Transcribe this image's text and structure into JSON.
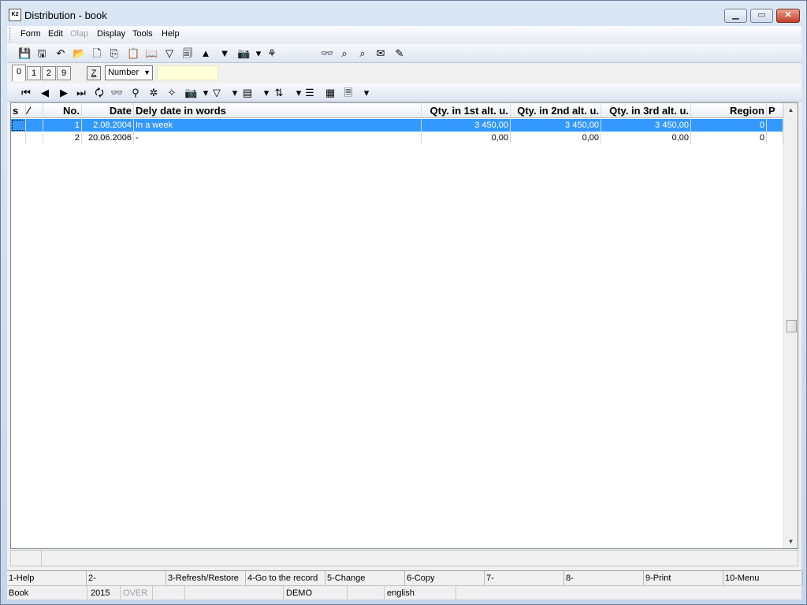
{
  "window": {
    "title": "Distribution - book",
    "icon_label": "K2",
    "min_glyph": "▁",
    "max_glyph": "▭",
    "close_glyph": "✕"
  },
  "menu": {
    "items": [
      {
        "label": "Form",
        "enabled": true
      },
      {
        "label": "Edit",
        "enabled": true
      },
      {
        "label": "Olap",
        "enabled": false
      },
      {
        "label": "Display",
        "enabled": true
      },
      {
        "label": "Tools",
        "enabled": true
      },
      {
        "label": "Help",
        "enabled": true
      }
    ]
  },
  "toolbar1": {
    "icons": [
      {
        "name": "save-icon",
        "glyph": "💾"
      },
      {
        "name": "save-disabled-icon",
        "glyph": "🖫"
      },
      {
        "name": "undo-icon",
        "glyph": "↶"
      },
      {
        "name": "open-folder-icon",
        "glyph": "📂"
      },
      {
        "name": "new-document-icon",
        "glyph": "🗋"
      },
      {
        "name": "copy-icon",
        "glyph": "⎘"
      },
      {
        "name": "paste-icon",
        "glyph": "📋"
      },
      {
        "name": "book-icon",
        "glyph": "📖"
      },
      {
        "name": "filter-icon",
        "glyph": "▽"
      },
      {
        "name": "filter-document-icon",
        "glyph": "🗐"
      },
      {
        "name": "arrow-up-icon",
        "glyph": "▲"
      },
      {
        "name": "arrow-down-icon",
        "glyph": "▼"
      },
      {
        "name": "camera-icon",
        "glyph": "📷"
      },
      {
        "name": "dropdown-icon",
        "glyph": "▾"
      },
      {
        "name": "plant-icon",
        "glyph": "⚘"
      },
      {
        "name": "binoculars-icon",
        "glyph": "👓"
      },
      {
        "name": "binoculars-find-icon",
        "glyph": "⌕"
      },
      {
        "name": "binoculars-next-icon",
        "glyph": "⌕"
      },
      {
        "name": "mail-icon",
        "glyph": "✉"
      },
      {
        "name": "disabled-edit-icon",
        "glyph": "✎"
      }
    ]
  },
  "tabs": {
    "items": [
      "0",
      "1",
      "2",
      "9"
    ],
    "active": "0",
    "z_button": "Z",
    "sort_select": "Number",
    "search_value": ""
  },
  "toolbar2": {
    "icons": [
      {
        "name": "first-record-icon",
        "glyph": "⏮"
      },
      {
        "name": "previous-record-icon",
        "glyph": "◀"
      },
      {
        "name": "next-record-icon",
        "glyph": "▶"
      },
      {
        "name": "last-record-icon",
        "glyph": "⏭"
      },
      {
        "name": "refresh-document-icon",
        "glyph": "🗘"
      },
      {
        "name": "binoculars-icon",
        "glyph": "👓"
      },
      {
        "name": "disabled-binoculars-icon",
        "glyph": "⚲"
      },
      {
        "name": "star-add-icon",
        "glyph": "✲"
      },
      {
        "name": "disabled-remove-icon",
        "glyph": "✧"
      },
      {
        "name": "camera-icon",
        "glyph": "📷"
      },
      {
        "name": "dropdown-icon",
        "glyph": "▾"
      },
      {
        "name": "filter-icon",
        "glyph": "▽"
      },
      {
        "name": "dropdown-icon",
        "glyph": "▾"
      },
      {
        "name": "columns-icon",
        "glyph": "▤"
      },
      {
        "name": "dropdown-icon",
        "glyph": "▾"
      },
      {
        "name": "sort-az-icon",
        "glyph": "⇅"
      },
      {
        "name": "dropdown-icon",
        "glyph": "▾"
      },
      {
        "name": "disabled-list-icon",
        "glyph": "☰"
      },
      {
        "name": "excel-icon",
        "glyph": "▦"
      },
      {
        "name": "report-icon",
        "glyph": "🗏"
      },
      {
        "name": "dropdown-icon",
        "glyph": "▾"
      }
    ]
  },
  "grid": {
    "columns": [
      {
        "key": "s",
        "label": "s",
        "align": "l"
      },
      {
        "key": "mark",
        "label": "⁄",
        "align": "l"
      },
      {
        "key": "no",
        "label": "No.",
        "align": "r"
      },
      {
        "key": "date",
        "label": "Date",
        "align": "r"
      },
      {
        "key": "words",
        "label": "Dely date in words",
        "align": "l"
      },
      {
        "key": "q1",
        "label": "Qty. in 1st alt. u.",
        "align": "r"
      },
      {
        "key": "q2",
        "label": "Qty. in 2nd alt. u.",
        "align": "r"
      },
      {
        "key": "q3",
        "label": "Qty. in 3rd alt. u.",
        "align": "r"
      },
      {
        "key": "region",
        "label": "Region",
        "align": "r"
      },
      {
        "key": "p",
        "label": "P",
        "align": "l"
      }
    ],
    "rows": [
      {
        "s": "",
        "mark": "",
        "no": "1",
        "date": "2.08.2004",
        "words": "In a week",
        "q1": "3 450,00",
        "q2": "3 450,00",
        "q3": "3 450,00",
        "region": "0",
        "p": "",
        "selected": true
      },
      {
        "s": "",
        "mark": "",
        "no": "2",
        "date": "20.06.2006",
        "words": "-",
        "q1": "0,00",
        "q2": "0,00",
        "q3": "0,00",
        "region": "0",
        "p": "",
        "selected": false
      }
    ]
  },
  "fkeys": [
    "1-Help",
    "2-",
    "3-Refresh/Restore",
    "4-Go to the record",
    "5-Change",
    "6-Copy",
    "7-",
    "8-",
    "9-Print",
    "10-Menu"
  ],
  "status": {
    "book": "Book",
    "year": "2015",
    "mode": "OVER",
    "blank1": "",
    "blank2": "",
    "demo": "DEMO",
    "blank3": "",
    "language": "english"
  },
  "colors": {
    "selection": "#3399ff",
    "search_input_bg": "#ffffd8",
    "close_button": "#c33f27"
  }
}
